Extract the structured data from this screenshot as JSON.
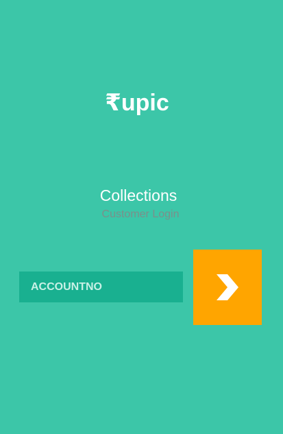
{
  "brand": {
    "logo_text": "₹upic"
  },
  "header": {
    "title": "Collections",
    "subtitle": "Customer Login"
  },
  "login": {
    "account_placeholder": "ACCOUNTNO",
    "account_value": "",
    "submit_icon": "chevron-right-icon"
  },
  "colors": {
    "background": "#3cc6a8",
    "input_background": "#19b090",
    "button_accent": "#ffa500"
  }
}
